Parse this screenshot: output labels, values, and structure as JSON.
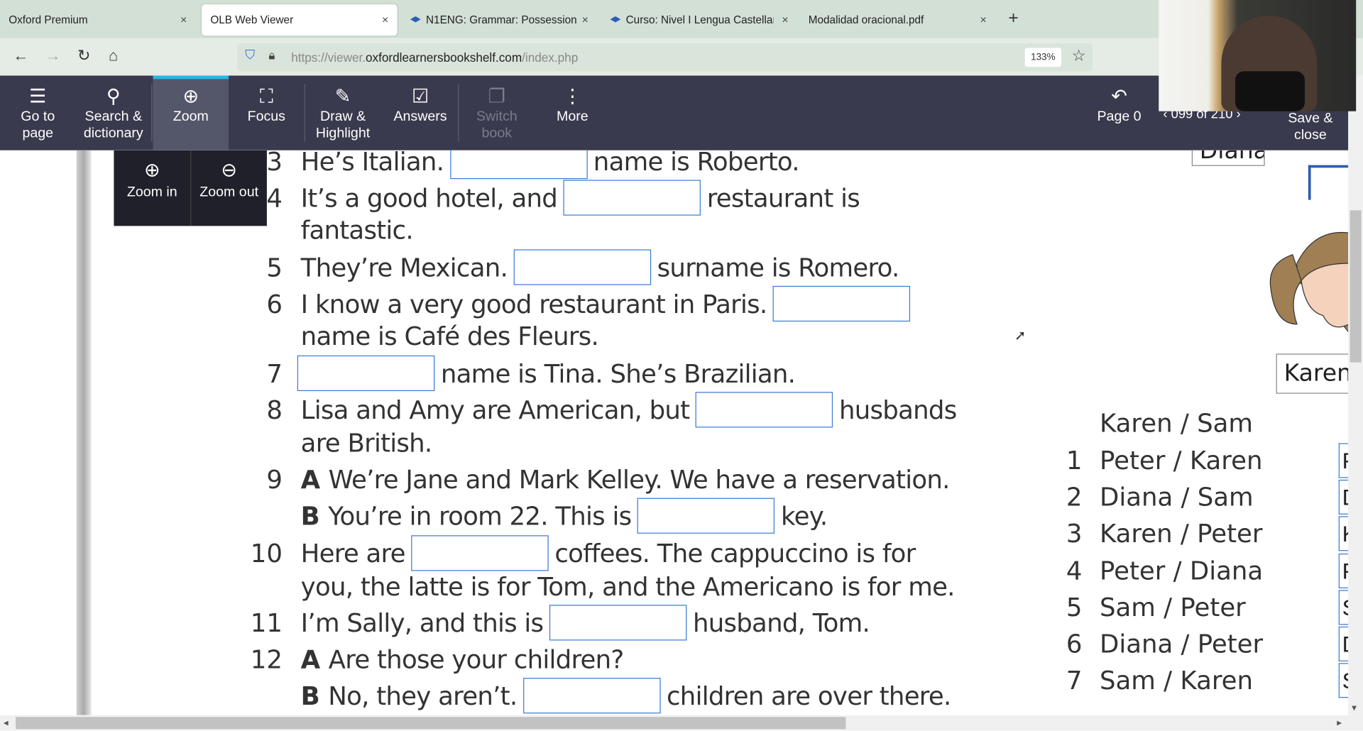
{
  "browser": {
    "tabs": [
      {
        "label": "Oxford Premium"
      },
      {
        "label": "OLB Web Viewer",
        "active": true
      },
      {
        "label": "N1ENG: Grammar: Possession"
      },
      {
        "label": "Curso: Nivel I Lengua Castellana"
      },
      {
        "label": "Modalidad oracional.pdf"
      }
    ],
    "close_glyph": "×",
    "new_tab": "+",
    "url_prefix": "https://viewer.",
    "url_domain": "oxfordlearnersbookshelf.com",
    "url_suffix": "/index.php",
    "zoom": "133%"
  },
  "toolbar": {
    "items": [
      {
        "label": "Go to page",
        "icon": "list-icon",
        "glyph": "☰"
      },
      {
        "label": "Search & dictionary",
        "icon": "search-icon",
        "glyph": "⚲"
      },
      {
        "label": "Zoom",
        "icon": "zoom-icon",
        "glyph": "⊕"
      },
      {
        "label": "Focus",
        "icon": "focus-icon",
        "glyph": "⛶"
      },
      {
        "label": "Draw & Highlight",
        "icon": "pen-icon",
        "glyph": "✎"
      },
      {
        "label": "Answers",
        "icon": "answers-icon",
        "glyph": "☑"
      },
      {
        "label": "Switch book",
        "icon": "switch-book-icon",
        "glyph": "❐"
      },
      {
        "label": "More",
        "icon": "more-icon",
        "glyph": "⋮"
      }
    ],
    "page_back": "Page 0",
    "page_counter": "099 of 210",
    "save_close": "Save & close",
    "zoom_in": "Zoom in",
    "zoom_out": "Zoom out"
  },
  "exercise": {
    "lines": [
      {
        "num": "3",
        "segs": [
          {
            "t": "He’s Italian."
          },
          {
            "input": ""
          },
          {
            "t": "name is Roberto."
          }
        ]
      },
      {
        "num": "4",
        "segs": [
          {
            "t": "It’s a good hotel, and"
          },
          {
            "input": ""
          },
          {
            "t": "restaurant is"
          }
        ]
      },
      {
        "num": "",
        "segs": [
          {
            "t": "fantastic."
          }
        ]
      },
      {
        "num": "5",
        "segs": [
          {
            "t": "They’re Mexican."
          },
          {
            "input": ""
          },
          {
            "t": "surname is Romero."
          }
        ]
      },
      {
        "num": "6",
        "segs": [
          {
            "t": "I know a very good restaurant in Paris."
          },
          {
            "input": ""
          }
        ]
      },
      {
        "num": "",
        "segs": [
          {
            "t": "name is Café des Fleurs."
          }
        ]
      },
      {
        "num": "7",
        "segs": [
          {
            "input": ""
          },
          {
            "t": "name is Tina. She’s Brazilian."
          }
        ]
      },
      {
        "num": "8",
        "segs": [
          {
            "t": "Lisa and Amy are American, but"
          },
          {
            "input": ""
          },
          {
            "t": "husbands"
          }
        ]
      },
      {
        "num": "",
        "segs": [
          {
            "t": "are British."
          }
        ]
      },
      {
        "num": "9",
        "segs": [
          {
            "b": "A"
          },
          {
            "t": "We’re Jane and Mark Kelley. We have a reservation."
          }
        ]
      },
      {
        "num": "",
        "segs": [
          {
            "b": "B"
          },
          {
            "t": "You’re in room 22. This is"
          },
          {
            "input": ""
          },
          {
            "t": "key."
          }
        ]
      },
      {
        "num": "10",
        "segs": [
          {
            "t": "Here are"
          },
          {
            "input": ""
          },
          {
            "t": "coffees. The cappuccino is for"
          }
        ]
      },
      {
        "num": "",
        "segs": [
          {
            "t": "you, the latte is for Tom, and the Americano is for me."
          }
        ]
      },
      {
        "num": "11",
        "segs": [
          {
            "t": "I’m Sally, and this is"
          },
          {
            "input": ""
          },
          {
            "t": "husband, Tom."
          }
        ]
      },
      {
        "num": "12",
        "segs": [
          {
            "b": "A"
          },
          {
            "t": "Are those your children?"
          }
        ]
      },
      {
        "num": "",
        "segs": [
          {
            "b": "B"
          },
          {
            "t": "No, they aren’t."
          },
          {
            "input": ""
          },
          {
            "t": "children are over there."
          }
        ]
      }
    ]
  },
  "pairs": {
    "example": "Karen / Sam",
    "items": [
      {
        "num": "1",
        "text": "Peter / Karen",
        "box": "P"
      },
      {
        "num": "2",
        "text": "Diana / Sam",
        "box": "D"
      },
      {
        "num": "3",
        "text": "Karen / Peter",
        "box": "K"
      },
      {
        "num": "4",
        "text": "Peter / Diana",
        "box": "P"
      },
      {
        "num": "5",
        "text": "Sam / Peter",
        "box": "S"
      },
      {
        "num": "6",
        "text": "Diana / Peter",
        "box": "D"
      },
      {
        "num": "7",
        "text": "Sam / Karen",
        "box": "S"
      }
    ],
    "name_labels": [
      "Diana",
      "Karen"
    ]
  },
  "colors": {
    "toolbar": "#393a4d",
    "accent": "#29b6e8",
    "input_border": "#3a7bd5"
  }
}
